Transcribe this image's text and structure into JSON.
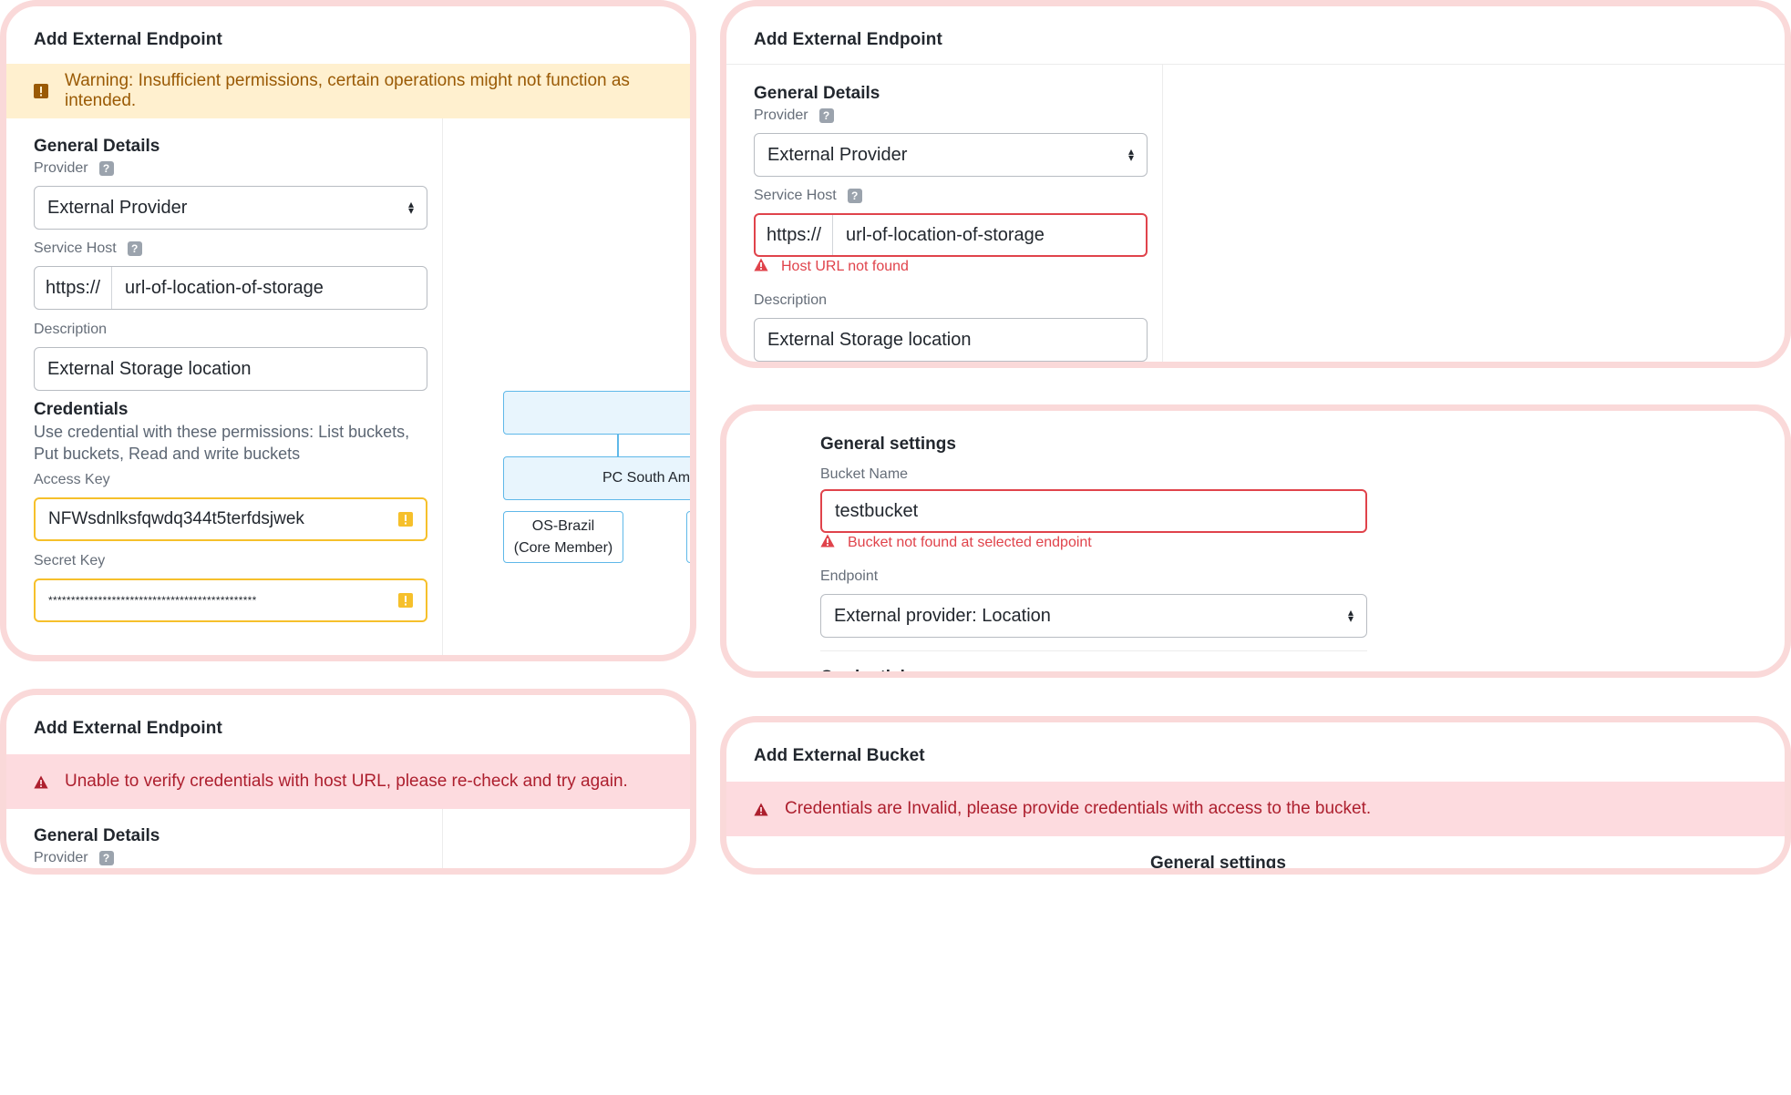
{
  "card1": {
    "title": "Add External Endpoint",
    "warning": "Warning: Insufficient permissions, certain operations might not function as intended.",
    "general_details": "General Details",
    "provider_label": "Provider",
    "help_glyph": "?",
    "provider_value": "External Provider",
    "service_host_label": "Service Host",
    "host_prefix": "https://",
    "host_value": "url-of-location-of-storage",
    "description_label": "Description",
    "description_value": "External Storage location",
    "credentials_heading": "Credentials",
    "credentials_text": "Use credential with these permissions: List buckets, Put buckets, Read and write buckets",
    "access_key_label": "Access Key",
    "access_key_value": "NFWsdnlksfqwdq344t5terfdsjwek",
    "secret_key_label": "Secret Key",
    "secret_key_value": "**********************************************",
    "diagram": {
      "node_mid": "PC South Americ",
      "node_left_line1": "OS-Brazil",
      "node_left_line2": "(Core Member)"
    }
  },
  "card2": {
    "title": "Add External Endpoint",
    "general_details": "General Details",
    "provider_label": "Provider",
    "help_glyph": "?",
    "provider_value": "External Provider",
    "service_host_label": "Service Host",
    "host_prefix": "https://",
    "host_value": "url-of-location-of-storage",
    "host_error": "Host URL not found",
    "description_label": "Description",
    "description_value": "External Storage location"
  },
  "card3": {
    "section": "General settings",
    "bucket_name_label": "Bucket Name",
    "bucket_name_value": "testbucket",
    "bucket_error": "Bucket not found at selected endpoint",
    "endpoint_label": "Endpoint",
    "endpoint_value": "External provider: Location",
    "credentials_partial": "Credentials"
  },
  "card4": {
    "title": "Add External Endpoint",
    "error": "Unable to verify credentials with host URL, please re-check and try again.",
    "general_details": "General Details",
    "provider_label": "Provider",
    "help_glyph": "?"
  },
  "card5": {
    "title": "Add External Bucket",
    "error": "Credentials are Invalid, please provide credentials with access to the bucket.",
    "section": "General settings"
  },
  "colors": {
    "card_border": "#fad9d9",
    "warning_bg": "#fff0cf",
    "warning_text": "#9a5a05",
    "error_bg": "#fddbdf",
    "error_text": "#ad1f2e",
    "field_error": "#e0434b",
    "field_warning": "#f6c02b",
    "diagram_stroke": "#5fb8e9"
  },
  "icons": {
    "warning_square": "exclamation-square-icon",
    "error_triangle": "alert-triangle-icon",
    "help": "question-mark-icon",
    "select": "sort-arrows-icon"
  }
}
